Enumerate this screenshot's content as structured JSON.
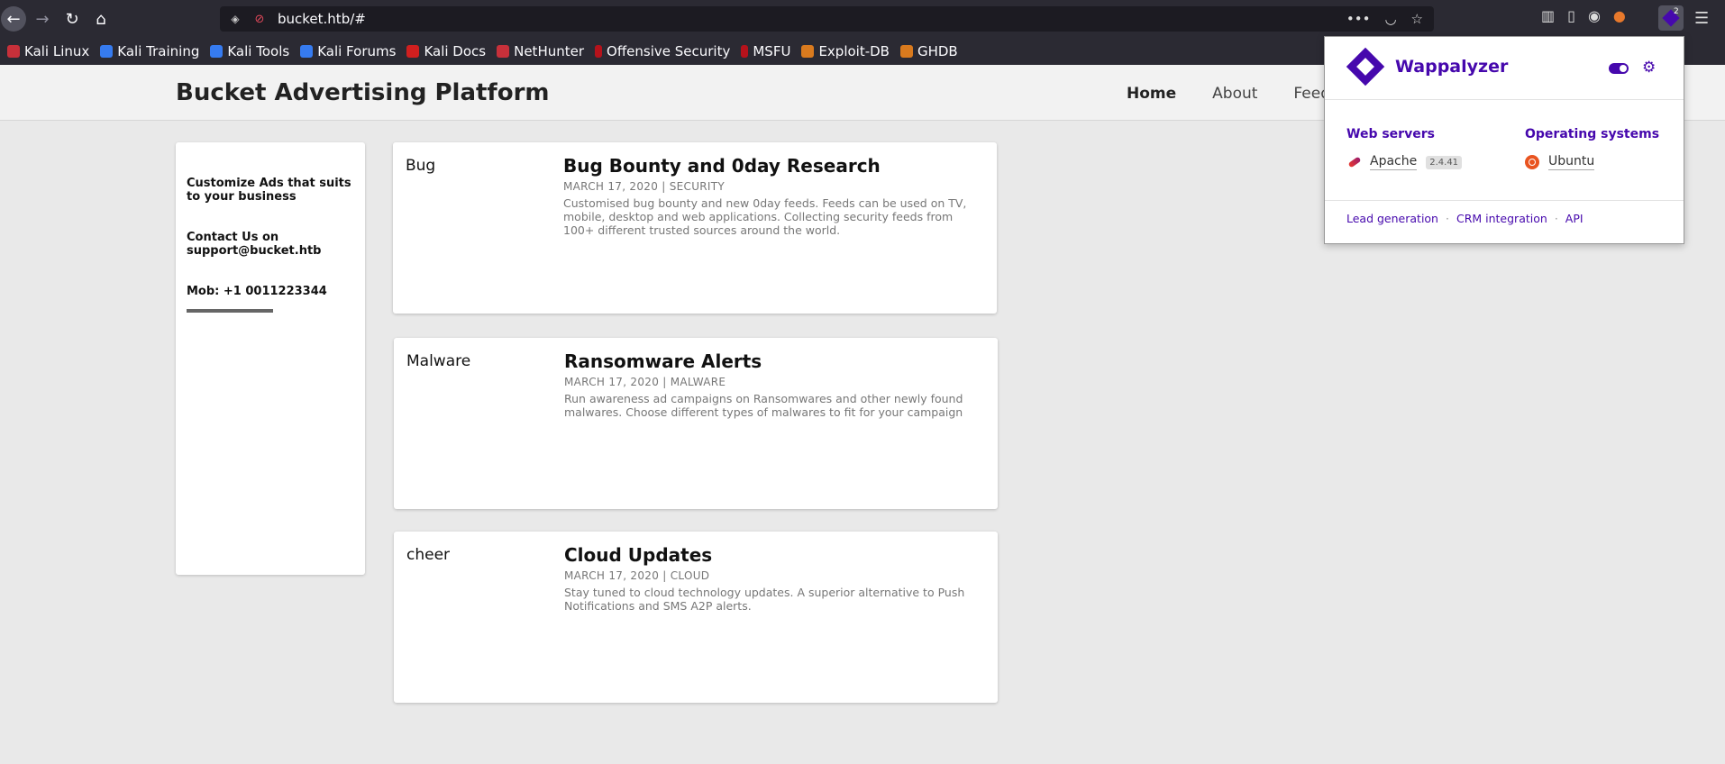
{
  "browser": {
    "url": "bucket.htb/#",
    "ext_badge": "2",
    "bookmarks": [
      "Kali Linux",
      "Kali Training",
      "Kali Tools",
      "Kali Forums",
      "Kali Docs",
      "NetHunter",
      "Offensive Security",
      "MSFU",
      "Exploit-DB",
      "GHDB"
    ]
  },
  "site": {
    "brand": "Bucket Advertising Platform",
    "nav": {
      "home": "Home",
      "about": "About",
      "feeds": "Feeds"
    },
    "sidebar": {
      "line1": "Customize Ads that suits to your business",
      "line2": "Contact Us on support@bucket.htb",
      "line3": "Mob: +1 0011223344"
    },
    "posts": [
      {
        "tag": "Bug",
        "title": "Bug Bounty and 0day Research",
        "meta": "MARCH 17, 2020 | SECURITY",
        "body": "Customised bug bounty and new 0day feeds. Feeds can be used on TV, mobile, desktop and web applications. Collecting security feeds from 100+ different trusted sources around the world."
      },
      {
        "tag": "Malware",
        "title": "Ransomware Alerts",
        "meta": "MARCH 17, 2020 | MALWARE",
        "body": "Run awareness ad campaigns on Ransomwares and other newly found malwares. Choose different types of malwares to fit for your campaign"
      },
      {
        "tag": "cheer",
        "title": "Cloud Updates",
        "meta": "MARCH 17, 2020 | CLOUD",
        "body": "Stay tuned to cloud technology updates. A superior alternative to Push Notifications and SMS A2P alerts."
      }
    ]
  },
  "wappalyzer": {
    "name": "Wappalyzer",
    "categories": {
      "web_servers": "Web servers",
      "operating_systems": "Operating systems"
    },
    "apache": {
      "name": "Apache",
      "version": "2.4.41"
    },
    "ubuntu": {
      "name": "Ubuntu"
    },
    "footer": {
      "lead": "Lead generation",
      "crm": "CRM integration",
      "api": "API"
    }
  },
  "colors": {
    "wappalyzer_purple": "#4608ad",
    "browser_chrome": "#2b2a33"
  }
}
